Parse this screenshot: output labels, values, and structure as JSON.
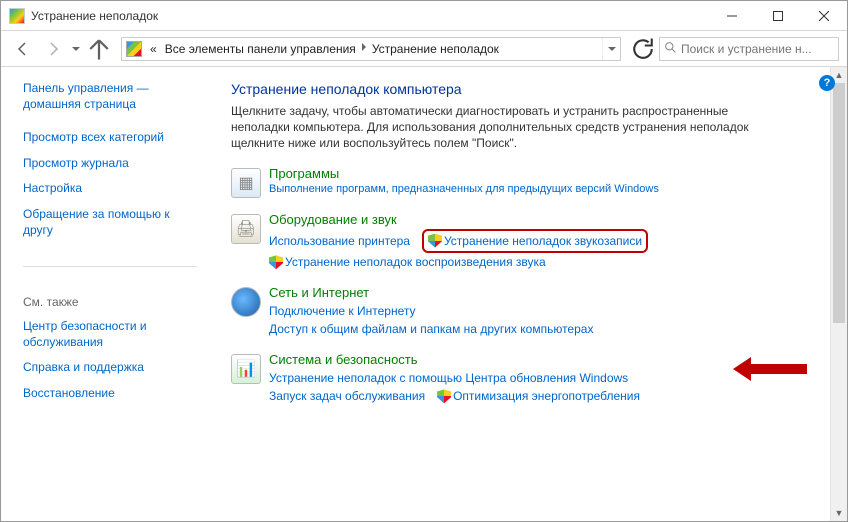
{
  "window": {
    "title": "Устранение неполадок"
  },
  "nav": {
    "crumb1": "Все элементы панели управления",
    "crumb2": "Устранение неполадок",
    "prefix": "«"
  },
  "search": {
    "placeholder": "Поиск и устранение н..."
  },
  "sidebar": {
    "home": "Панель управления — домашняя страница",
    "links": [
      "Просмотр всех категорий",
      "Просмотр журнала",
      "Настройка",
      "Обращение за помощью к другу"
    ],
    "seealso_label": "См. также",
    "seealso": [
      "Центр безопасности и обслуживания",
      "Справка и поддержка",
      "Восстановление"
    ]
  },
  "main": {
    "title": "Устранение неполадок компьютера",
    "desc": "Щелкните задачу, чтобы автоматически диагностировать и устранить распространенные неполадки компьютера. Для использования дополнительных средств устранения неполадок щелкните ниже или воспользуйтесь полем \"Поиск\".",
    "categories": [
      {
        "heading": "Программы",
        "sub": "Выполнение программ, предназначенных для предыдущих версий Windows",
        "links": []
      },
      {
        "heading": "Оборудование и звук",
        "sub": "",
        "links": [
          {
            "text": "Использование принтера",
            "shield": false,
            "highlight": false
          },
          {
            "text": "Устранение неполадок звукозаписи",
            "shield": true,
            "highlight": true
          },
          {
            "text": "Устранение неполадок воспроизведения звука",
            "shield": true,
            "highlight": false
          }
        ]
      },
      {
        "heading": "Сеть и Интернет",
        "sub": "",
        "links": [
          {
            "text": "Подключение к Интернету",
            "shield": false,
            "highlight": false
          },
          {
            "text": "Доступ к общим файлам и папкам на других компьютерах",
            "shield": false,
            "highlight": false
          }
        ]
      },
      {
        "heading": "Система и безопасность",
        "sub": "",
        "links": [
          {
            "text": "Устранение неполадок с помощью Центра обновления Windows",
            "shield": false,
            "highlight": false
          },
          {
            "text": "Запуск задач обслуживания",
            "shield": false,
            "highlight": false
          },
          {
            "text": "Оптимизация энергопотребления",
            "shield": true,
            "highlight": false
          }
        ]
      }
    ]
  }
}
